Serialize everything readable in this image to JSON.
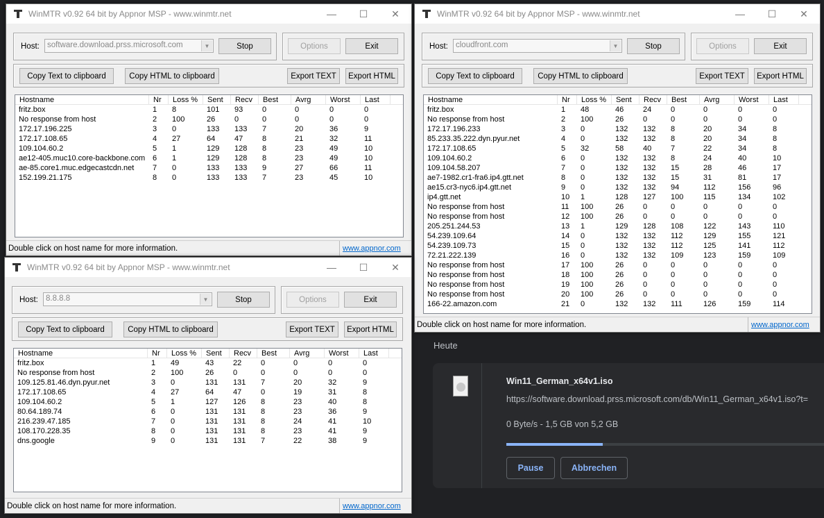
{
  "app_title": "WinMTR v0.92 64 bit by Appnor MSP - www.winmtr.net",
  "labels": {
    "host": "Host:",
    "stop": "Stop",
    "options": "Options",
    "exit": "Exit",
    "copy_text": "Copy Text to clipboard",
    "copy_html": "Copy HTML to clipboard",
    "export_text": "Export TEXT",
    "export_html": "Export HTML",
    "status": "Double click on host name for more information.",
    "link": "www.appnor.com",
    "minimize": "—",
    "maximize": "☐",
    "close": "✕"
  },
  "columns": [
    "Hostname",
    "Nr",
    "Loss %",
    "Sent",
    "Recv",
    "Best",
    "Avrg",
    "Worst",
    "Last"
  ],
  "windows": [
    {
      "host": "software.download.prss.microsoft.com",
      "rows": [
        [
          "fritz.box",
          "1",
          "8",
          "101",
          "93",
          "0",
          "0",
          "0",
          "0"
        ],
        [
          "No response from host",
          "2",
          "100",
          "26",
          "0",
          "0",
          "0",
          "0",
          "0"
        ],
        [
          "172.17.196.225",
          "3",
          "0",
          "133",
          "133",
          "7",
          "20",
          "36",
          "9"
        ],
        [
          "172.17.108.65",
          "4",
          "27",
          "64",
          "47",
          "8",
          "21",
          "32",
          "11"
        ],
        [
          "109.104.60.2",
          "5",
          "1",
          "129",
          "128",
          "8",
          "23",
          "49",
          "10"
        ],
        [
          "ae12-405.muc10.core-backbone.com",
          "6",
          "1",
          "129",
          "128",
          "8",
          "23",
          "49",
          "10"
        ],
        [
          "ae-85.core1.muc.edgecastcdn.net",
          "7",
          "0",
          "133",
          "133",
          "9",
          "27",
          "66",
          "11"
        ],
        [
          "152.199.21.175",
          "8",
          "0",
          "133",
          "133",
          "7",
          "23",
          "45",
          "10"
        ]
      ]
    },
    {
      "host": "cloudfront.com",
      "rows": [
        [
          "fritz.box",
          "1",
          "48",
          "46",
          "24",
          "0",
          "0",
          "0",
          "0"
        ],
        [
          "No response from host",
          "2",
          "100",
          "26",
          "0",
          "0",
          "0",
          "0",
          "0"
        ],
        [
          "172.17.196.233",
          "3",
          "0",
          "132",
          "132",
          "8",
          "20",
          "34",
          "8"
        ],
        [
          "85.233.35.222.dyn.pyur.net",
          "4",
          "0",
          "132",
          "132",
          "8",
          "20",
          "34",
          "8"
        ],
        [
          "172.17.108.65",
          "5",
          "32",
          "58",
          "40",
          "7",
          "22",
          "34",
          "8"
        ],
        [
          "109.104.60.2",
          "6",
          "0",
          "132",
          "132",
          "8",
          "24",
          "40",
          "10"
        ],
        [
          "109.104.58.207",
          "7",
          "0",
          "132",
          "132",
          "15",
          "28",
          "46",
          "17"
        ],
        [
          "ae7-1982.cr1-fra6.ip4.gtt.net",
          "8",
          "0",
          "132",
          "132",
          "15",
          "31",
          "81",
          "17"
        ],
        [
          "ae15.cr3-nyc6.ip4.gtt.net",
          "9",
          "0",
          "132",
          "132",
          "94",
          "112",
          "156",
          "96"
        ],
        [
          "ip4.gtt.net",
          "10",
          "1",
          "128",
          "127",
          "100",
          "115",
          "134",
          "102"
        ],
        [
          "No response from host",
          "11",
          "100",
          "26",
          "0",
          "0",
          "0",
          "0",
          "0"
        ],
        [
          "No response from host",
          "12",
          "100",
          "26",
          "0",
          "0",
          "0",
          "0",
          "0"
        ],
        [
          "205.251.244.53",
          "13",
          "1",
          "129",
          "128",
          "108",
          "122",
          "143",
          "110"
        ],
        [
          "54.239.109.64",
          "14",
          "0",
          "132",
          "132",
          "112",
          "129",
          "155",
          "121"
        ],
        [
          "54.239.109.73",
          "15",
          "0",
          "132",
          "132",
          "112",
          "125",
          "141",
          "112"
        ],
        [
          "72.21.222.139",
          "16",
          "0",
          "132",
          "132",
          "109",
          "123",
          "159",
          "109"
        ],
        [
          "No response from host",
          "17",
          "100",
          "26",
          "0",
          "0",
          "0",
          "0",
          "0"
        ],
        [
          "No response from host",
          "18",
          "100",
          "26",
          "0",
          "0",
          "0",
          "0",
          "0"
        ],
        [
          "No response from host",
          "19",
          "100",
          "26",
          "0",
          "0",
          "0",
          "0",
          "0"
        ],
        [
          "No response from host",
          "20",
          "100",
          "26",
          "0",
          "0",
          "0",
          "0",
          "0"
        ],
        [
          "166-22.amazon.com",
          "21",
          "0",
          "132",
          "132",
          "111",
          "126",
          "159",
          "114"
        ]
      ]
    },
    {
      "host": "8.8.8.8",
      "rows": [
        [
          "fritz.box",
          "1",
          "49",
          "43",
          "22",
          "0",
          "0",
          "0",
          "0"
        ],
        [
          "No response from host",
          "2",
          "100",
          "26",
          "0",
          "0",
          "0",
          "0",
          "0"
        ],
        [
          "109.125.81.46.dyn.pyur.net",
          "3",
          "0",
          "131",
          "131",
          "7",
          "20",
          "32",
          "9"
        ],
        [
          "172.17.108.65",
          "4",
          "27",
          "64",
          "47",
          "0",
          "19",
          "31",
          "8"
        ],
        [
          "109.104.60.2",
          "5",
          "1",
          "127",
          "126",
          "8",
          "23",
          "40",
          "8"
        ],
        [
          "80.64.189.74",
          "6",
          "0",
          "131",
          "131",
          "8",
          "23",
          "36",
          "9"
        ],
        [
          "216.239.47.185",
          "7",
          "0",
          "131",
          "131",
          "8",
          "24",
          "41",
          "10"
        ],
        [
          "108.170.228.35",
          "8",
          "0",
          "131",
          "131",
          "8",
          "23",
          "41",
          "9"
        ],
        [
          "dns.google",
          "9",
          "0",
          "131",
          "131",
          "7",
          "22",
          "38",
          "9"
        ]
      ]
    }
  ],
  "downloads": {
    "section": "Heute",
    "file_name": "Win11_German_x64v1.iso",
    "url": "https://software.download.prss.microsoft.com/db/Win11_German_x64v1.iso?t=",
    "status": "0 Byte/s - 1,5 GB von 5,2 GB",
    "progress_percent": 29,
    "pause": "Pause",
    "cancel": "Abbrechen",
    "accent": "#8ab4f8"
  }
}
